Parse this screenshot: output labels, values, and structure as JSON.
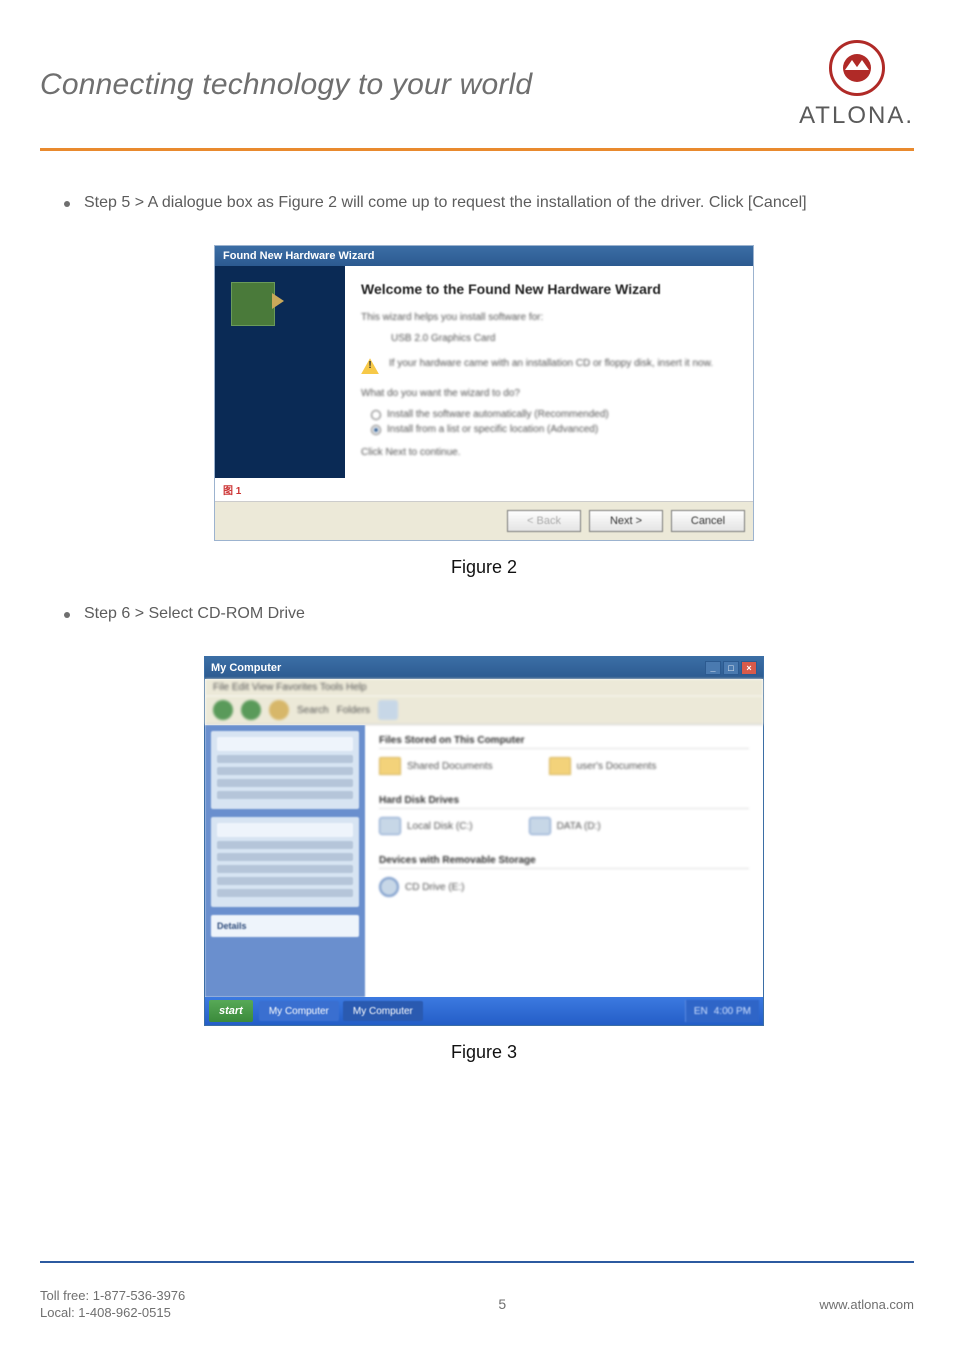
{
  "header": {
    "tagline": "Connecting technology to your world",
    "brand": "ATLONA."
  },
  "steps": {
    "step5": "Step 5 > A dialogue box as Figure 2 will come up to request the installation of the driver. Click [Cancel]",
    "step6": "Step 6 > Select CD-ROM Drive"
  },
  "figure2": {
    "titlebar": "Found New Hardware Wizard",
    "heading": "Welcome to the Found New Hardware Wizard",
    "line1": "This wizard helps you install software for:",
    "device": "USB 2.0 Graphics Card",
    "warn": "If your hardware came with an installation CD or floppy disk, insert it now.",
    "question": "What do you want the wizard to do?",
    "radio1": "Install the software automatically (Recommended)",
    "radio2": "Install from a list or specific location (Advanced)",
    "continue_text": "Click Next to continue.",
    "tag": "图 1",
    "btn_back": "< Back",
    "btn_next": "Next >",
    "btn_cancel": "Cancel",
    "caption": "Figure 2"
  },
  "figure3": {
    "titlebar": "My Computer",
    "menubar": "File   Edit   View   Favorites   Tools   Help",
    "toolbar_search": "Search",
    "toolbar_folders": "Folders",
    "side_details": "Details",
    "section_files": "Files Stored on This Computer",
    "section_hdd": "Hard Disk Drives",
    "section_removable": "Devices with Removable Storage",
    "items": [
      "Shared Documents",
      "user's Documents",
      "Local Disk (C:)",
      "DATA (D:)",
      "CD Drive (E:)"
    ],
    "start": "start",
    "tasks": [
      "My Computer",
      "My Computer"
    ],
    "tray_lang": "EN",
    "tray_time": "4:00 PM",
    "caption": "Figure 3"
  },
  "footer": {
    "tollfree": "Toll free: 1-877-536-3976",
    "local": "Local: 1-408-962-0515",
    "page": "5",
    "url": "www.atlona.com"
  }
}
